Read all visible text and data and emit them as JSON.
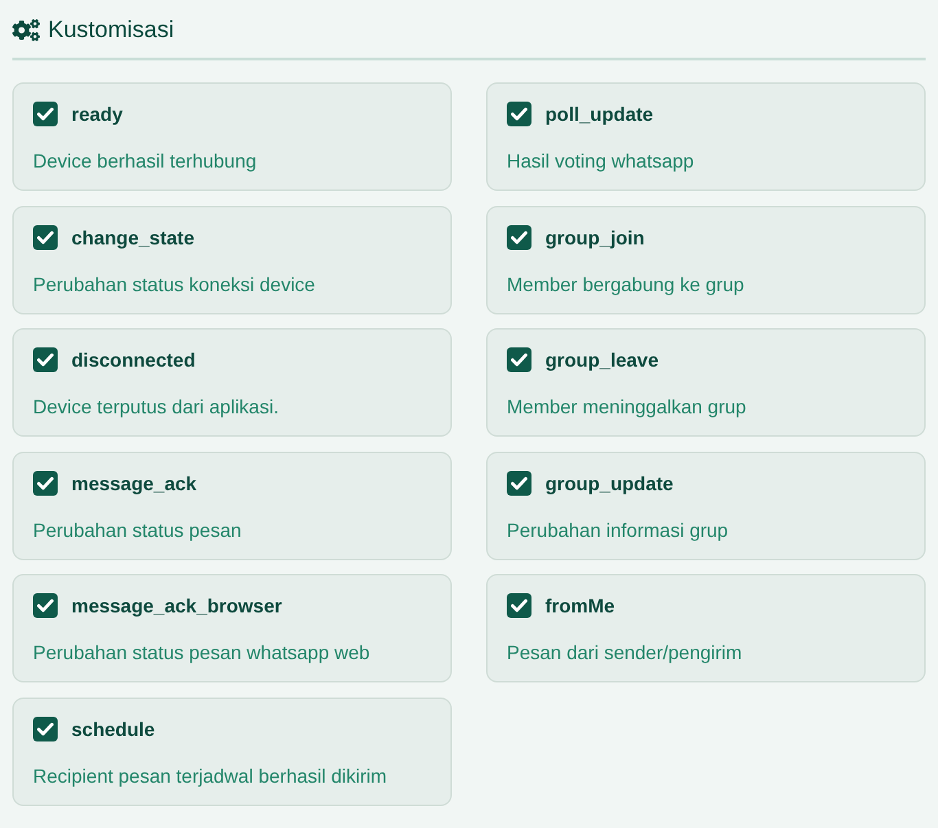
{
  "header": {
    "title": "Kustomisasi"
  },
  "events": [
    {
      "name": "ready",
      "description": "Device berhasil terhubung",
      "checked": true
    },
    {
      "name": "poll_update",
      "description": "Hasil voting whatsapp",
      "checked": true
    },
    {
      "name": "change_state",
      "description": "Perubahan status koneksi device",
      "checked": true
    },
    {
      "name": "group_join",
      "description": "Member bergabung ke grup",
      "checked": true
    },
    {
      "name": "disconnected",
      "description": "Device terputus dari aplikasi.",
      "checked": true
    },
    {
      "name": "group_leave",
      "description": "Member meninggalkan grup",
      "checked": true
    },
    {
      "name": "message_ack",
      "description": "Perubahan status pesan",
      "checked": true
    },
    {
      "name": "group_update",
      "description": "Perubahan informasi grup",
      "checked": true
    },
    {
      "name": "message_ack_browser",
      "description": "Perubahan status pesan whatsapp web",
      "checked": true
    },
    {
      "name": "fromMe",
      "description": "Pesan dari sender/pengirim",
      "checked": true
    },
    {
      "name": "schedule",
      "description": "Recipient pesan terjadwal berhasil dikirim",
      "checked": true
    }
  ]
}
